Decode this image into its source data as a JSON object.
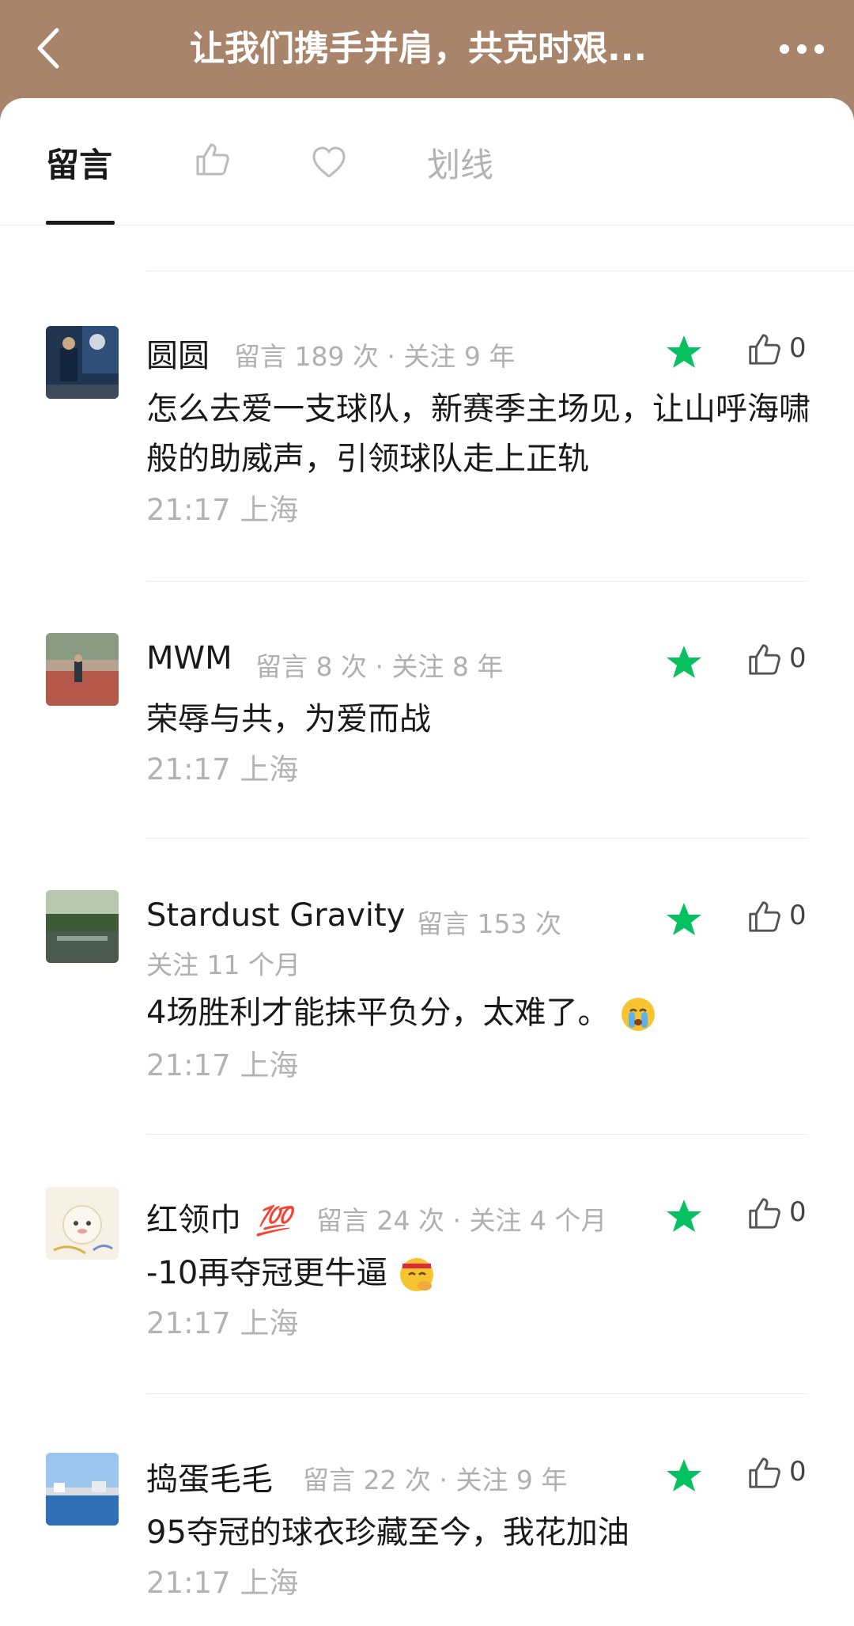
{
  "header": {
    "title": "让我们携手并肩，共克时艰...",
    "back_icon": "chevron-left-icon",
    "more_icon": "more-horizontal-icon"
  },
  "tabs": [
    {
      "label": "留言",
      "active": true
    },
    {
      "icon": "thumbs-up-icon",
      "active": false
    },
    {
      "icon": "heart-icon",
      "active": false
    },
    {
      "label": "划线",
      "active": false
    }
  ],
  "colors": {
    "header_bg": "#a8856a",
    "star_green": "#07c160"
  },
  "comments": [
    {
      "name": "圆圆",
      "meta": "留言 189 次 · 关注 9 年",
      "meta2": "",
      "text": "怎么去爱一支球队，新赛季主场见，让山呼海啸般的助威声，引领球队走上正轨",
      "time": "21:17  上海",
      "likes": "0",
      "badge": ""
    },
    {
      "name": "MWM",
      "meta": "留言 8 次 · 关注 8 年",
      "meta2": "",
      "text": "荣辱与共，为爱而战",
      "time": "21:17  上海",
      "likes": "0",
      "badge": ""
    },
    {
      "name": "Stardust Gravity",
      "meta": "留言 153 次",
      "meta2": "关注 11 个月",
      "text": "4场胜利才能抹平负分，太难了。",
      "time": "21:17  上海",
      "likes": "0",
      "badge": "",
      "emoji": "crying-face-emoji"
    },
    {
      "name": "红领巾",
      "meta": "留言 24 次 · 关注 4 个月",
      "meta2": "",
      "text": "-10再夺冠更牛逼",
      "time": "21:17  上海",
      "likes": "0",
      "badge": "💯",
      "emoji": "thinking-face-emoji"
    },
    {
      "name": "捣蛋毛毛",
      "meta": "留言 22 次 · 关注 9 年",
      "meta2": "",
      "text": "95夺冠的球衣珍藏至今，我花加油",
      "time": "21:17  上海",
      "likes": "0",
      "badge": ""
    }
  ]
}
